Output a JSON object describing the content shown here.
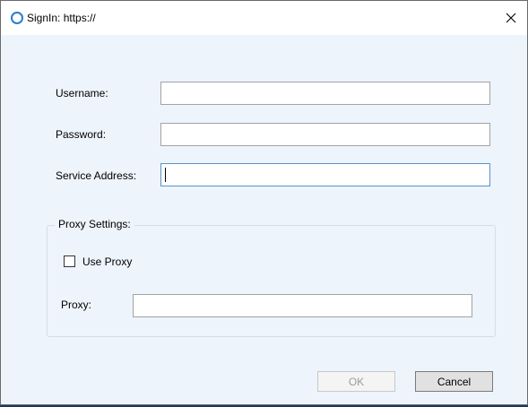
{
  "window": {
    "title": "SignIn: https://",
    "accent_color": "#2b7bd1"
  },
  "form": {
    "username_label": "Username:",
    "username_value": "",
    "password_label": "Password:",
    "password_value": "",
    "service_address_label": "Service Address:",
    "service_address_value": ""
  },
  "proxy": {
    "group_label": "Proxy Settings:",
    "use_proxy_label": "Use Proxy",
    "use_proxy_checked": false,
    "proxy_label": "Proxy:",
    "proxy_value": ""
  },
  "buttons": {
    "ok_label": "OK",
    "ok_enabled": false,
    "cancel_label": "Cancel"
  },
  "icons": {
    "app": "ring-icon",
    "close": "close-icon"
  }
}
